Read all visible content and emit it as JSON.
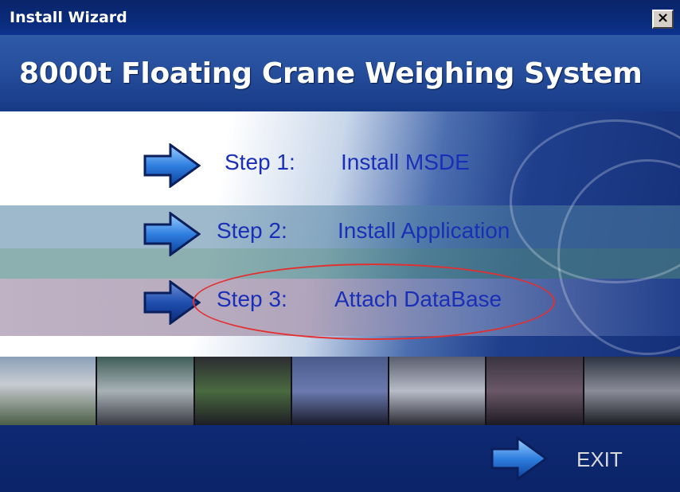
{
  "window": {
    "title": "Install Wizard",
    "close_label": "×"
  },
  "banner": {
    "title": "8000t Floating Crane Weighing System"
  },
  "steps": [
    {
      "label": "Step 1:",
      "name": "Install MSDE"
    },
    {
      "label": "Step 2:",
      "name": "Install Application"
    },
    {
      "label": "Step 3:",
      "name": "Attach DataBase"
    }
  ],
  "footer": {
    "exit_label": "EXIT"
  },
  "colors": {
    "title_bar": "#0a246a",
    "step_text": "#1a2fb8",
    "arrow": "#2f7fe0",
    "highlight": "#e23030"
  }
}
